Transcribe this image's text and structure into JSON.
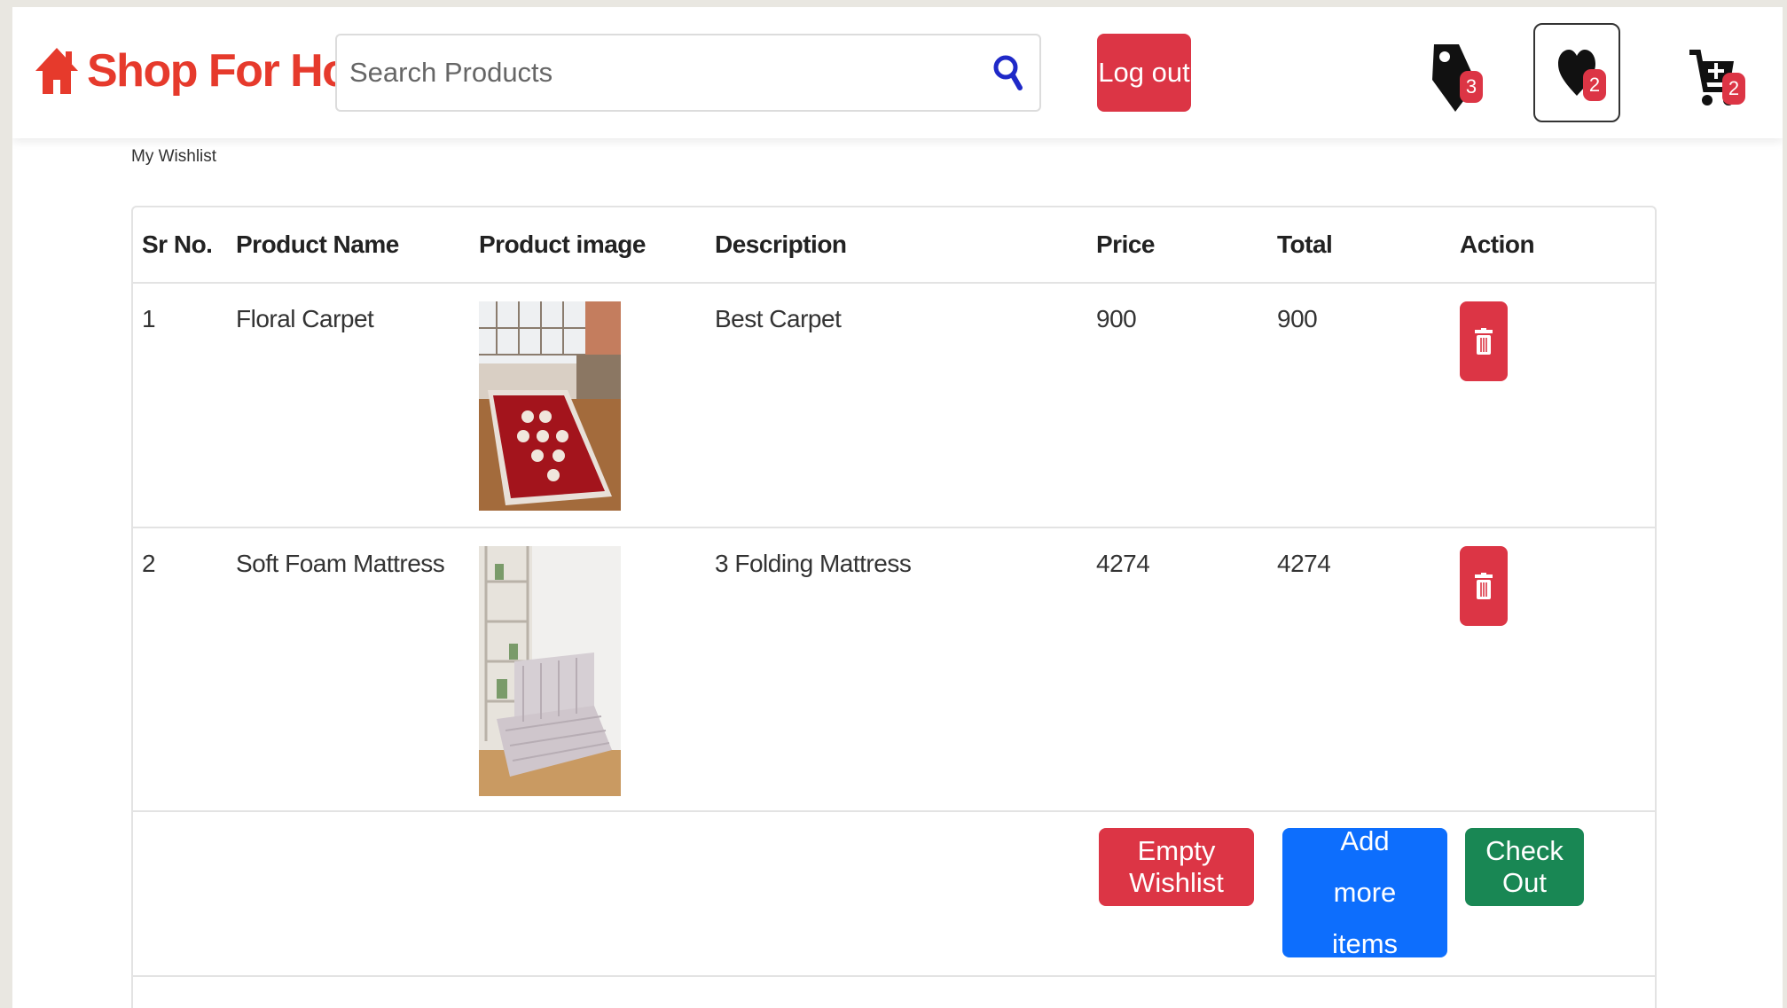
{
  "header": {
    "brand_name": "Shop For Home",
    "search_placeholder": "Search Products",
    "logout_label": "Log out",
    "tags_count": "3",
    "wishlist_count": "2",
    "cart_count": "2"
  },
  "page": {
    "label": "My Wishlist"
  },
  "table": {
    "headers": [
      "Sr No.",
      "Product Name",
      "Product image",
      "Description",
      "Price",
      "Total",
      "Action"
    ],
    "rows": [
      {
        "sr": "1",
        "name": "Floral Carpet",
        "description": "Best Carpet",
        "price": "900",
        "total": "900"
      },
      {
        "sr": "2",
        "name": "Soft Foam Mattress",
        "description": "3 Folding Mattress",
        "price": "4274",
        "total": "4274"
      }
    ]
  },
  "actions": {
    "empty_label": "Empty Wishlist",
    "add_more_label": "Add more items",
    "checkout_label": "Check Out"
  },
  "colors": {
    "brand": "#e63a2c",
    "danger": "#dc3545",
    "primary": "#0d6efd",
    "success": "#198754"
  }
}
